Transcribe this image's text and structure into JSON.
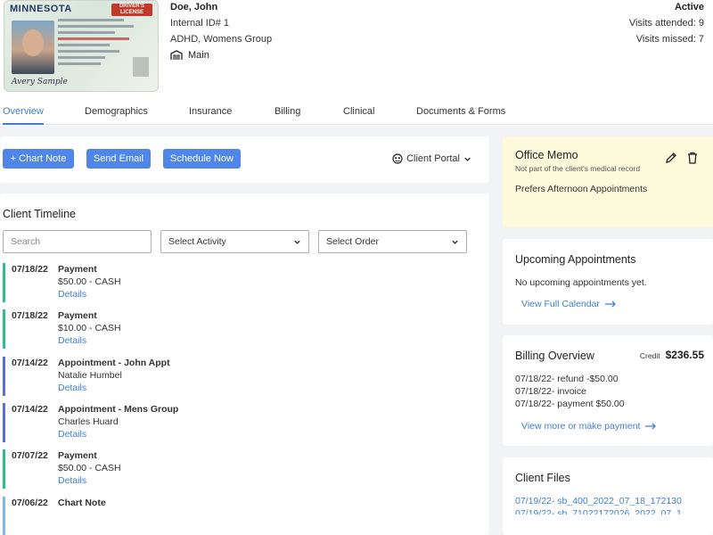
{
  "client": {
    "name": "Doe, John",
    "internal_id": "Internal ID# 1",
    "groups": "ADHD, Womens Group",
    "location": "Main",
    "status": "Active",
    "visits_attended": "Visits attended: 9",
    "visits_missed": "Visits missed: 7"
  },
  "id_card": {
    "state": "MINNESOTA",
    "license_label": "DRIVER'S LICENSE",
    "signature": "Avery Sample"
  },
  "tabs": [
    {
      "label": "Overview",
      "active": true
    },
    {
      "label": "Demographics"
    },
    {
      "label": "Insurance"
    },
    {
      "label": "Billing"
    },
    {
      "label": "Clinical"
    },
    {
      "label": "Documents & Forms"
    }
  ],
  "actions": {
    "chart_note": "+ Chart Note",
    "send_email": "Send Email",
    "schedule_now": "Schedule Now",
    "client_portal": "Client Portal"
  },
  "timeline": {
    "title": "Client Timeline",
    "search_placeholder": "Search",
    "select_activity": "Select Activity",
    "select_order": "Select Order",
    "entries": [
      {
        "date": "07/18/22",
        "title": "Payment",
        "sub": "$50.00 - CASH",
        "link": "Details",
        "color": "#2dbf86"
      },
      {
        "date": "07/18/22",
        "title": "Payment",
        "sub": "$10.00 - CASH",
        "link": "Details",
        "color": "#2dbf86"
      },
      {
        "date": "07/14/22",
        "title": "Appointment - John Appt",
        "sub": "Natalie Humbel",
        "link": "Details",
        "color": "#5a6fdc"
      },
      {
        "date": "07/14/22",
        "title": "Appointment - Mens Group",
        "sub": "Charles Huard",
        "link": "Details",
        "color": "#5a6fdc"
      },
      {
        "date": "07/07/22",
        "title": "Payment",
        "sub": "$50.00 - CASH",
        "link": "Details",
        "color": "#2dbf86"
      },
      {
        "date": "07/06/22",
        "title": "Chart Note",
        "sub": "",
        "link": "",
        "color": "#7cb7e6"
      }
    ]
  },
  "memo": {
    "title": "Office Memo",
    "subtitle": "Not part of the client's medical record",
    "body": "Prefers Afternoon Appointments"
  },
  "upcoming": {
    "title": "Upcoming Appointments",
    "empty": "No upcoming appointments yet.",
    "link": "View Full Calendar"
  },
  "billing": {
    "title": "Billing Overview",
    "credit_label": "Credit",
    "credit_amount": "$236.55",
    "items": [
      "07/18/22- refund -$50.00",
      "07/18/22- invoice",
      "07/18/22- payment $50.00"
    ],
    "link": "View more or make payment"
  },
  "files": {
    "title": "Client Files",
    "items": [
      "07/19/22- sb_400_2022_07_18_172130",
      "07/19/22- sb_71022172026_2022_07_1"
    ]
  },
  "colors": {
    "accent": "#4f86e8",
    "link": "#3d7fd6",
    "memo_bg": "#fdfadb",
    "payment_bar": "#2dbf86",
    "appointment_bar": "#5a6fdc"
  }
}
